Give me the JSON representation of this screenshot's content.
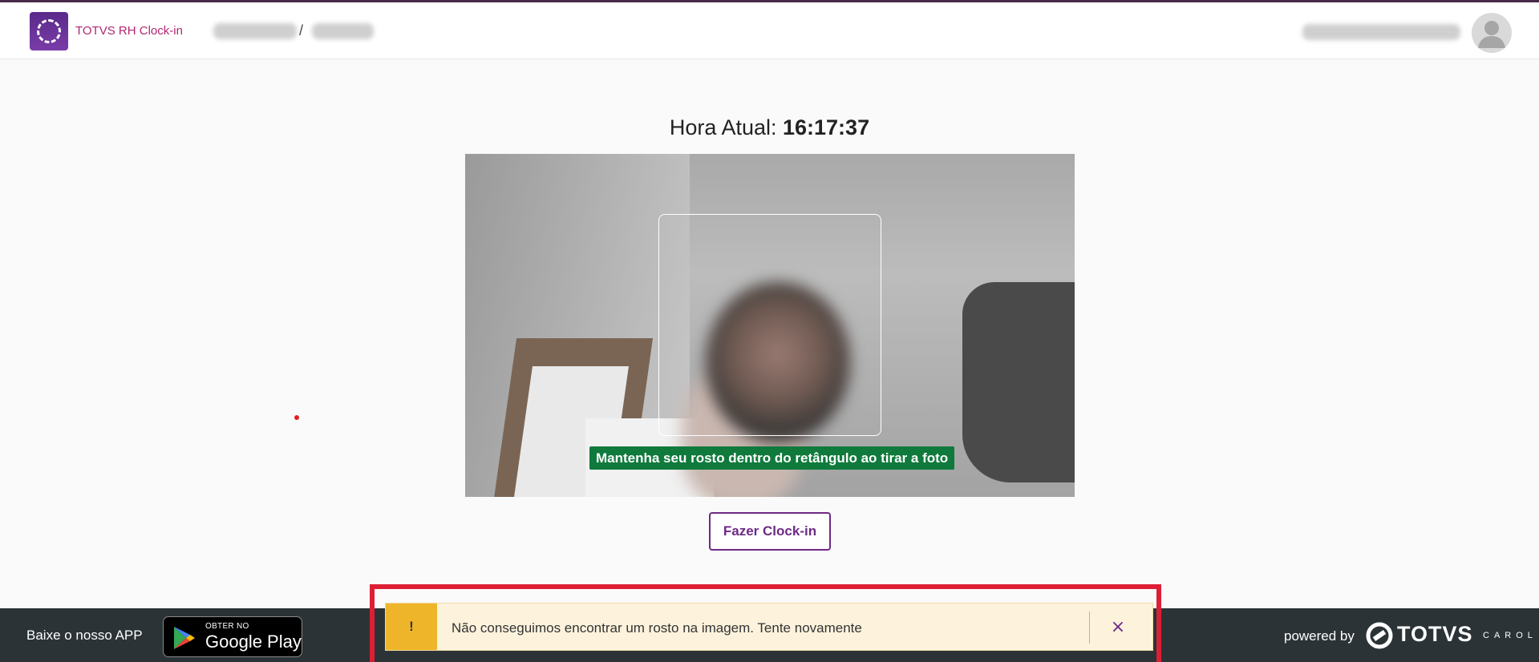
{
  "app": {
    "title": "TOTVS RH Clock-in",
    "breadcrumb_separator": "/"
  },
  "main": {
    "clock_label": "Hora Atual:",
    "clock_time": "16:17:37",
    "camera_hint": "Mantenha seu rosto dentro do retângulo ao tirar a foto",
    "clockin_button": "Fazer Clock-in"
  },
  "toast": {
    "badge": "!",
    "message": "Não conseguimos encontrar um rosto na imagem. Tente novamente",
    "close": "×"
  },
  "footer": {
    "download_text": "Baixe o nosso APP",
    "store_small": "OBTER NO",
    "store_big": "Google Play",
    "powered_by": "powered by",
    "brand": "TOTVS",
    "brand_sub": "CAROL"
  },
  "colors": {
    "brand_purple": "#6e2a86",
    "title_pink": "#b1276f",
    "hint_green": "#0f7a3c",
    "toast_bg": "#fdf3dd",
    "toast_badge": "#efb52a",
    "highlight_red": "#dd1f35",
    "footer_bg": "#2b3336"
  }
}
